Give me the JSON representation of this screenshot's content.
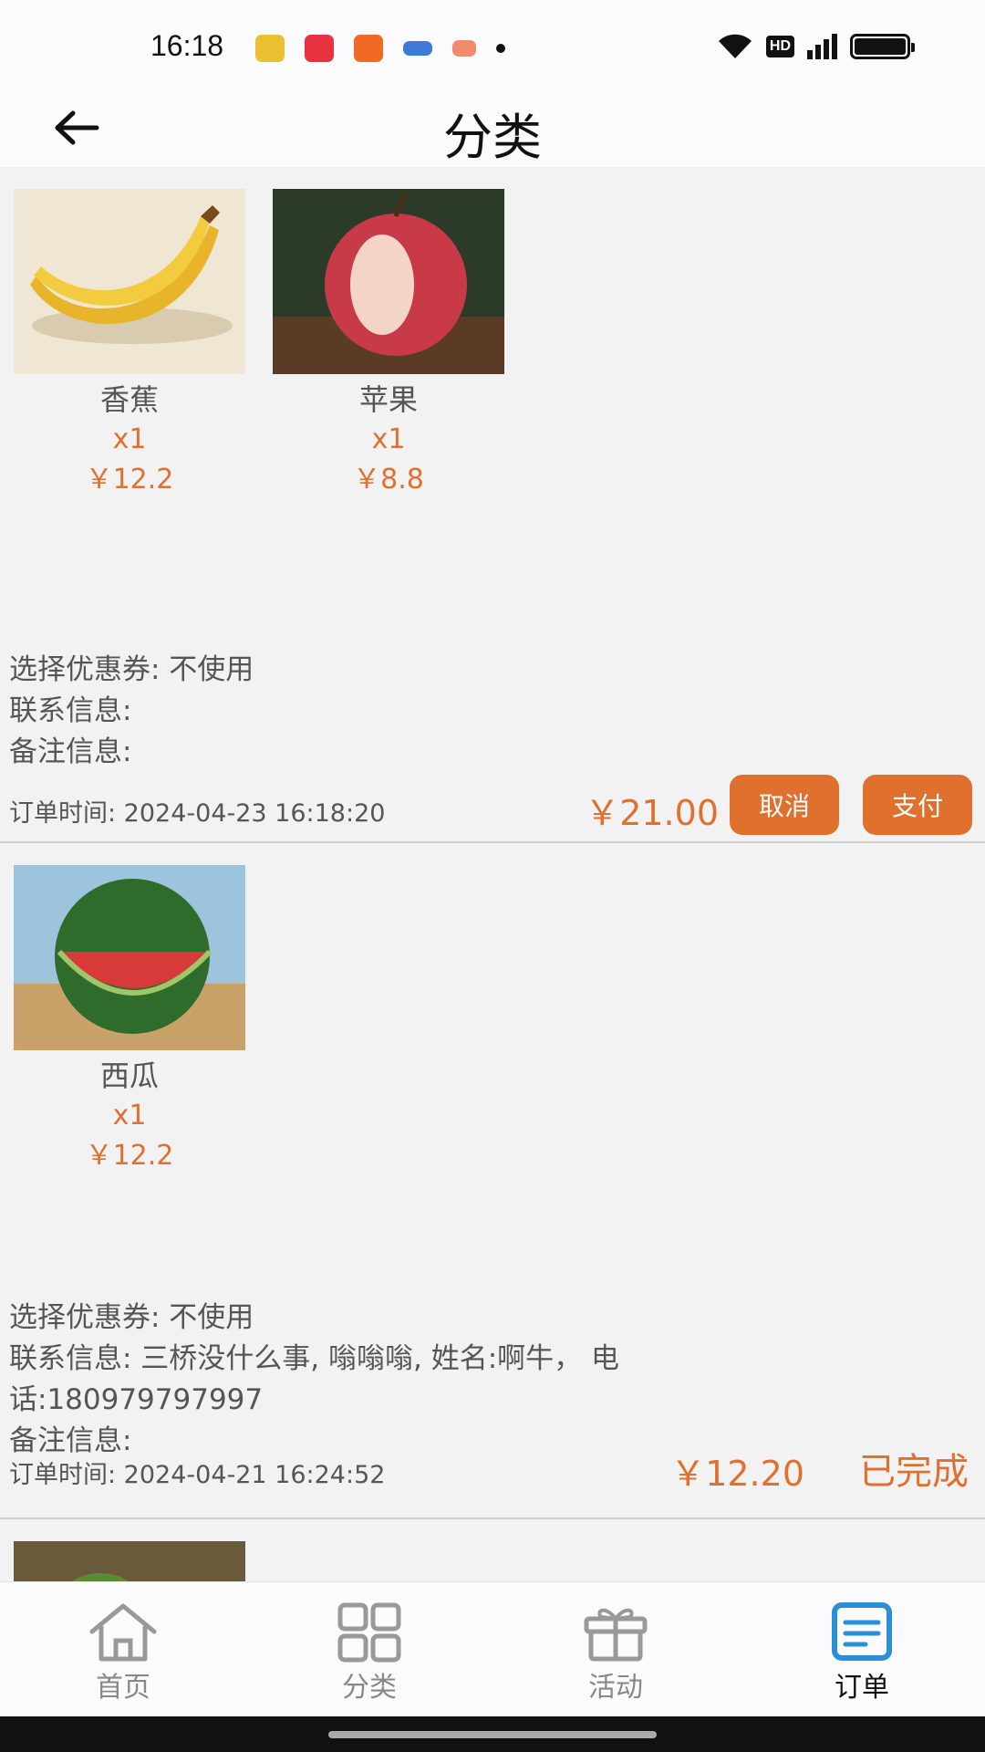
{
  "status_bar": {
    "time": "16:18",
    "network_label": "HD"
  },
  "header": {
    "title": "分类"
  },
  "orders": [
    {
      "products": [
        {
          "name": "香蕉",
          "qty": "x1",
          "price": "￥12.2"
        },
        {
          "name": "苹果",
          "qty": "x1",
          "price": "￥8.8"
        }
      ],
      "coupon": "选择优惠券: 不使用",
      "contact": "联系信息:",
      "remark": "备注信息:",
      "time": "订单时间: 2024-04-23 16:18:20",
      "total": "￥21.00",
      "cancel_label": "取消",
      "pay_label": "支付"
    },
    {
      "products": [
        {
          "name": "西瓜",
          "qty": "x1",
          "price": "￥12.2"
        }
      ],
      "coupon": "选择优惠券: 不使用",
      "contact": "联系信息: 三桥没什么事, 嗡嗡嗡, 姓名:啊牛， 电话:180979797997",
      "remark": "备注信息:",
      "time": "订单时间: 2024-04-21 16:24:52",
      "total": "￥12.20",
      "status": "已完成"
    }
  ],
  "bottom_nav": {
    "items": [
      {
        "label": "首页",
        "icon": "home-icon"
      },
      {
        "label": "分类",
        "icon": "grid-icon"
      },
      {
        "label": "活动",
        "icon": "gift-icon"
      },
      {
        "label": "订单",
        "icon": "order-icon",
        "active": true
      }
    ]
  },
  "colors": {
    "accent": "#e0702e",
    "active_icon": "#2a8fd6"
  }
}
